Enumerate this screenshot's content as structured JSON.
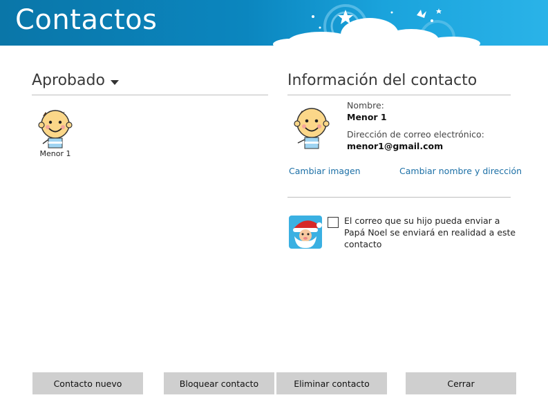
{
  "header": {
    "title": "Contactos"
  },
  "left_panel": {
    "title": "Aprobado",
    "contacts": [
      {
        "name": "Menor 1"
      }
    ]
  },
  "right_panel": {
    "title": "Información del contacto",
    "name_label": "Nombre:",
    "name_value": "Menor 1",
    "email_label": "Dirección de correo electrónico:",
    "email_value": "menor1@gmail.com",
    "change_image_link": "Cambiar imagen",
    "change_name_link": "Cambiar nombre y dirección",
    "santa_checkbox_text": "El correo que su hijo pueda enviar a Papá Noel se enviará en realidad a este contacto",
    "santa_checkbox_checked": false
  },
  "buttons": {
    "new_contact": "Contacto nuevo",
    "block_contact": "Bloquear contacto",
    "delete_contact": "Eliminar contacto",
    "close": "Cerrar"
  },
  "colors": {
    "header": "#0b86bf",
    "link": "#1b6fa6",
    "button": "#cfcfcf"
  },
  "icons": [
    "boy-avatar-icon",
    "santa-icon",
    "dropdown-arrow-icon",
    "checkbox"
  ]
}
